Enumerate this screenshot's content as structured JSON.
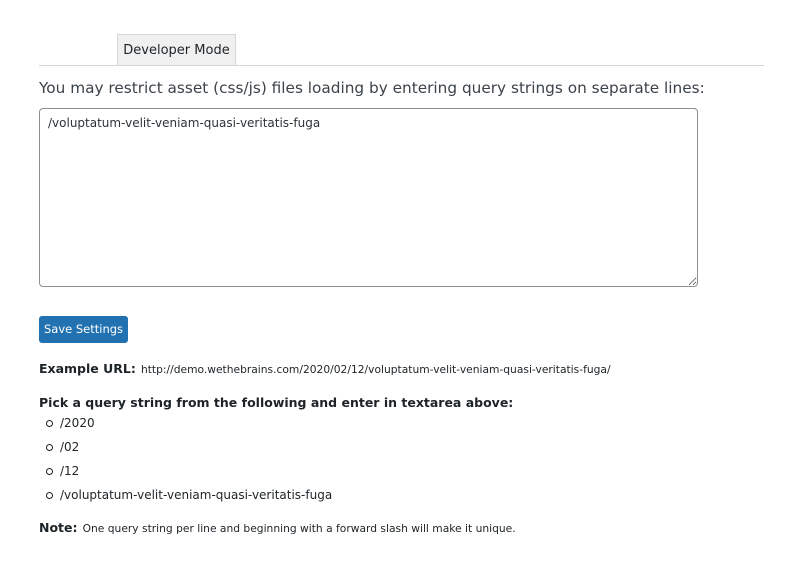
{
  "tabs": {
    "developer_mode": "Developer Mode"
  },
  "instructions": "You may restrict asset (css/js) files loading by entering query strings on separate lines:",
  "textarea": {
    "value": "/voluptatum-velit-veniam-quasi-veritatis-fuga"
  },
  "save_button": "Save Settings",
  "example": {
    "label": "Example URL:",
    "url": "http://demo.wethebrains.com/2020/02/12/voluptatum-velit-veniam-quasi-veritatis-fuga/"
  },
  "pick": {
    "heading": "Pick a query string from the following and enter in textarea above:",
    "items": [
      "/2020",
      "/02",
      "/12",
      "/voluptatum-velit-veniam-quasi-veritatis-fuga"
    ]
  },
  "note": {
    "label": "Note:",
    "text": "One query string per line and beginning with a forward slash will make it unique."
  },
  "colors": {
    "primary_button": "#2271b1",
    "text": "#3c434a",
    "border": "#8c8f94"
  }
}
